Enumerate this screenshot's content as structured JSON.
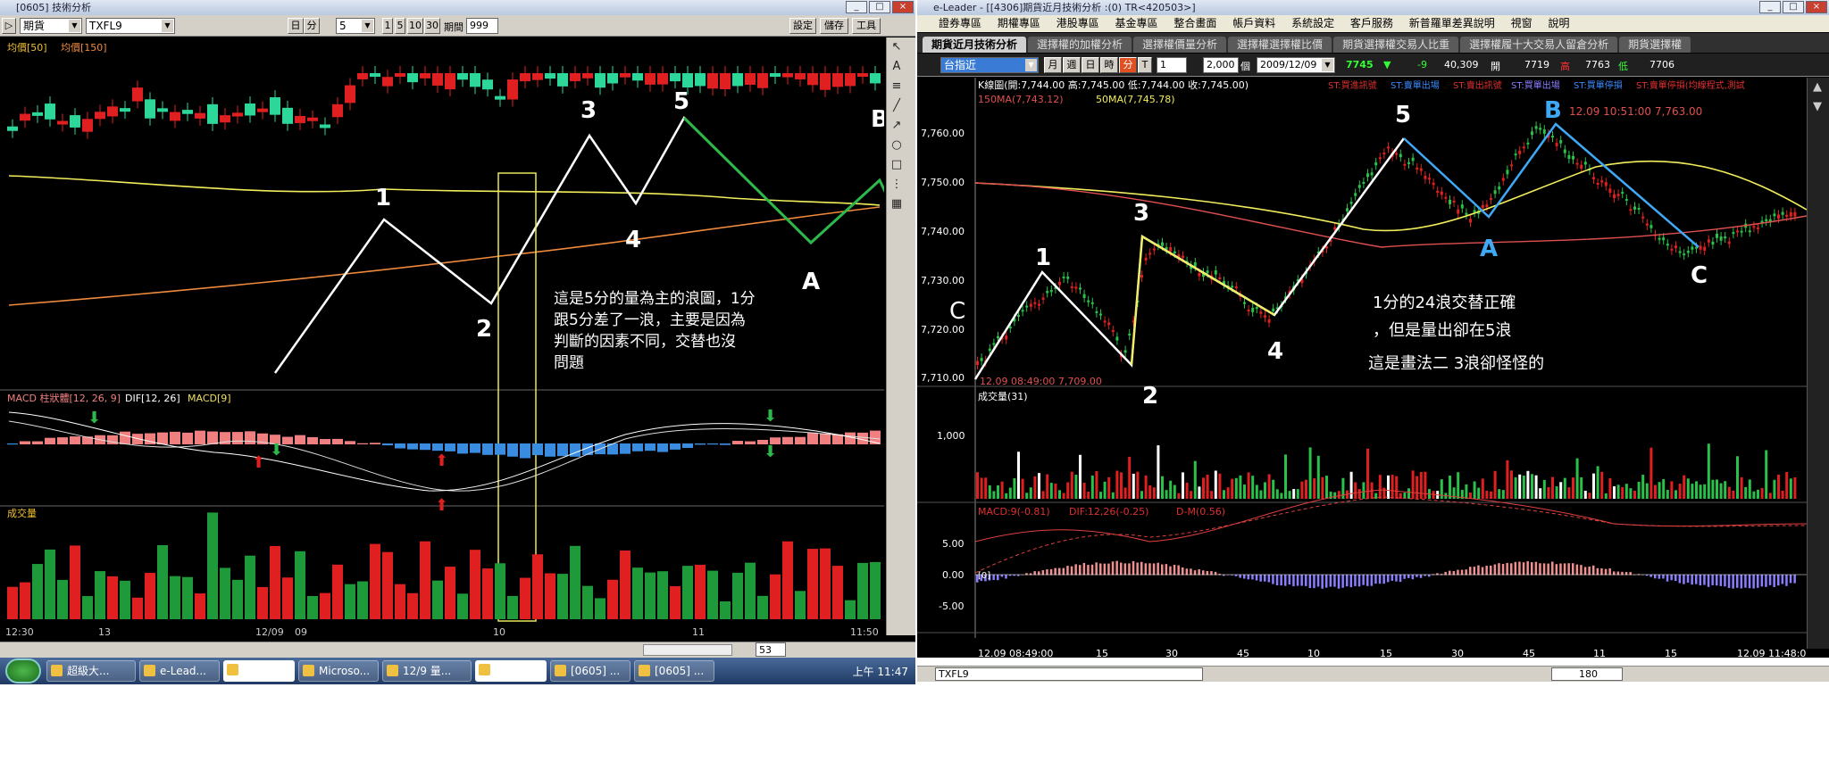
{
  "left_window": {
    "title": "[0605] 技術分析",
    "toolbar": {
      "market_select": "期貨",
      "symbol_select": "TXFL9",
      "day_btn": "日",
      "min_btn": "分",
      "period_select": "5",
      "num_btns": [
        "1",
        "5",
        "10",
        "30"
      ],
      "period_label": "期間",
      "period_value": "999",
      "settings_btn": "設定",
      "save_btn": "儲存",
      "tools_btn": "工具"
    },
    "legend": {
      "price": "均價[50]",
      "price2": "均價[150]"
    },
    "wave_labels": {
      "w1": "1",
      "w2": "2",
      "w3": "3",
      "w4": "4",
      "w5": "5",
      "wa": "A",
      "wb": "B"
    },
    "annotation": [
      "這是5分的量為主的浪圖，1分",
      "跟5分差了一浪，主要是因為",
      "判斷的因素不同，交替也沒",
      "問題"
    ],
    "macd_legend": {
      "a": "MACD 柱狀體[12, 26, 9]",
      "b": "DIF[12, 26]",
      "c": "MACD[9]"
    },
    "volume_label": "成交量",
    "x_labels": [
      "12:30",
      "13",
      "12/09",
      "09",
      "10",
      "11",
      "11:50"
    ],
    "scroll_value": "53"
  },
  "right_window": {
    "title": "e-Leader - [[4306]期貨近月技術分析 :(0) TR<420503>]",
    "menu": [
      "證券專區",
      "期權專區",
      "港股專區",
      "基金專區",
      "整合畫面",
      "帳戶資料",
      "系統設定",
      "客戶服務",
      "新普羅單差異說明",
      "視窗",
      "說明"
    ],
    "tabs": [
      "期貨近月技術分析",
      "選擇權的加權分析",
      "選擇權價量分析",
      "選擇權選擇權比價",
      "期貨選擇權交易人比重",
      "選擇權履十大交易人留倉分析",
      "期貨選擇權"
    ],
    "toolbar": {
      "symbol": "台指近",
      "period_btns": [
        "月",
        "週",
        "日",
        "時",
        "分",
        "T"
      ],
      "num1": "1",
      "count": "2,000",
      "count_unit": "個",
      "date": "2009/12/09",
      "last": "7745",
      "change": "-9",
      "volume": "40,309",
      "open_label": "開",
      "open": "7719",
      "high_label": "高",
      "high": "7763",
      "low_label": "低",
      "low": "7706"
    },
    "k_header": "K線圖(開:7,744.00 高:7,745.00 低:7,744.00 收:7,745.00)",
    "signals": [
      "ST:買進訊號",
      "ST:賣單出場",
      "ST:賣出訊號",
      "ST:買單出場",
      "ST:買單停損",
      "ST:賣單停損(均線程式,測試"
    ],
    "ma_legend": {
      "ma150": "150MA(7,743.12)",
      "ma50": "50MA(7,745.78)"
    },
    "y_ticks": [
      "7,760.00",
      "7,750.00",
      "7,740.00",
      "7,730.00",
      "7,720.00",
      "7,710.00"
    ],
    "high_mark": "12.09 10:51:00  7,763.00",
    "low_mark": "12.09 08:49:00  7,709.00",
    "wave_labels": {
      "c_left": "C",
      "w1": "1",
      "w2": "2",
      "w3": "3",
      "w4": "4",
      "w5": "5",
      "wa": "A",
      "wb": "B",
      "wc": "C"
    },
    "annotation": [
      "1分的24浪交替正確",
      "，但是量出卻在5浪",
      "這是畫法二 3浪卻怪怪的"
    ],
    "volume_header": "成交量(31)",
    "volume_tick": "1,000",
    "macd_header": "MACD:9(-0.81)",
    "dif_header": "DIF:12,26(-0.25)",
    "dm_header": "D-M(0.56)",
    "macd_ticks": [
      "5.00",
      "0.00",
      "-5.00"
    ],
    "macd_zero_tag": "[0]",
    "x_ticks": [
      "12.09 08:49:00",
      "15",
      "30",
      "45",
      "10",
      "15",
      "30",
      "45",
      "11",
      "15",
      "12.09 11:48:00"
    ],
    "status_symbol": "TXFL9",
    "status_value": "180"
  },
  "taskbar": {
    "items": [
      "超級大...",
      "e-Lead...",
      "",
      "Microso...",
      "12/9 量...",
      "",
      "[0605] ...",
      "[0605] ..."
    ],
    "clock": "上午 11:47"
  }
}
